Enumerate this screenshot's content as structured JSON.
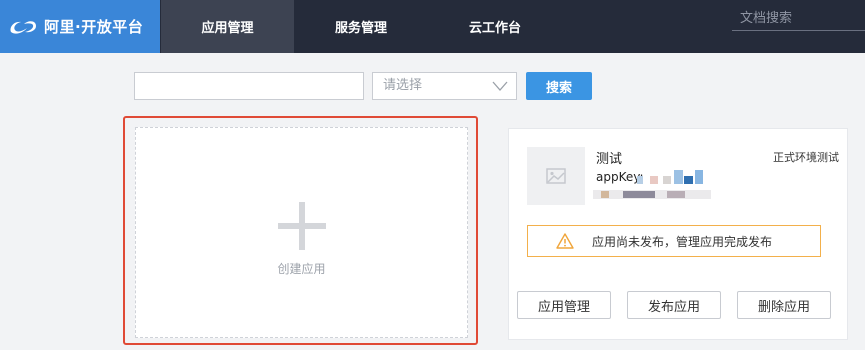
{
  "brand": {
    "name": "阿里·开放平台"
  },
  "nav": {
    "tabs": [
      {
        "label": "应用管理"
      },
      {
        "label": "服务管理"
      },
      {
        "label": "云工作台"
      }
    ],
    "doc_search_placeholder": "文档搜索"
  },
  "filter": {
    "input_value": "",
    "select_placeholder": "请选择",
    "search_button": "搜索"
  },
  "create": {
    "label": "创建应用"
  },
  "app_card": {
    "name": "测试",
    "environment": "正式环境测试",
    "appkey_label": "appKey:",
    "warning": "应用尚未发布，管理应用完成发布",
    "buttons": {
      "manage": "应用管理",
      "publish": "发布应用",
      "delete": "删除应用"
    }
  },
  "colors": {
    "nav_bg": "#252b3a",
    "brand_bg": "#3a86d8",
    "primary": "#3b95e3",
    "highlight_border": "#e04a36",
    "warning": "#f3b04b"
  }
}
